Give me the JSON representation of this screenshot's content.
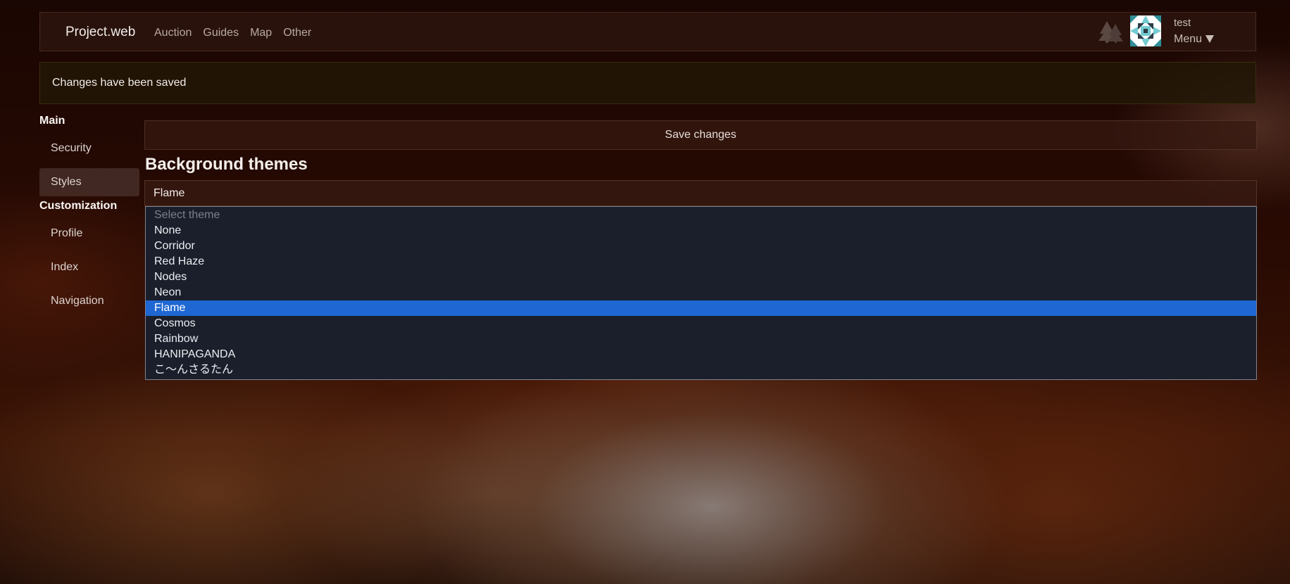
{
  "navbar": {
    "brand": "Project.web",
    "links": [
      "Auction",
      "Guides",
      "Map",
      "Other"
    ],
    "user": "test",
    "menu_label": "Menu",
    "icons": [
      "trees-icon",
      "avatar-identicon",
      "triangle-down-icon"
    ]
  },
  "alert": {
    "message": "Changes have been saved"
  },
  "sidebar": {
    "sections": [
      {
        "title": "Main",
        "items": [
          "Security",
          "Styles"
        ]
      },
      {
        "title": "Customization",
        "items": [
          "Profile",
          "Index",
          "Navigation"
        ]
      }
    ],
    "active": "Styles"
  },
  "main": {
    "save_label": "Save changes",
    "section_title": "Background themes",
    "select": {
      "value": "Flame",
      "placeholder": "Select theme",
      "options": [
        "None",
        "Corridor",
        "Red Haze",
        "Nodes",
        "Neon",
        "Flame",
        "Cosmos",
        "Rainbow",
        "HANIPAGANDA",
        "こ〜んさるたん"
      ],
      "highlighted": "Flame"
    }
  },
  "colors": {
    "highlight": "#1f67d2",
    "dropdown_bg": "#1a1f2b",
    "panel_bg": "#2d1610"
  }
}
